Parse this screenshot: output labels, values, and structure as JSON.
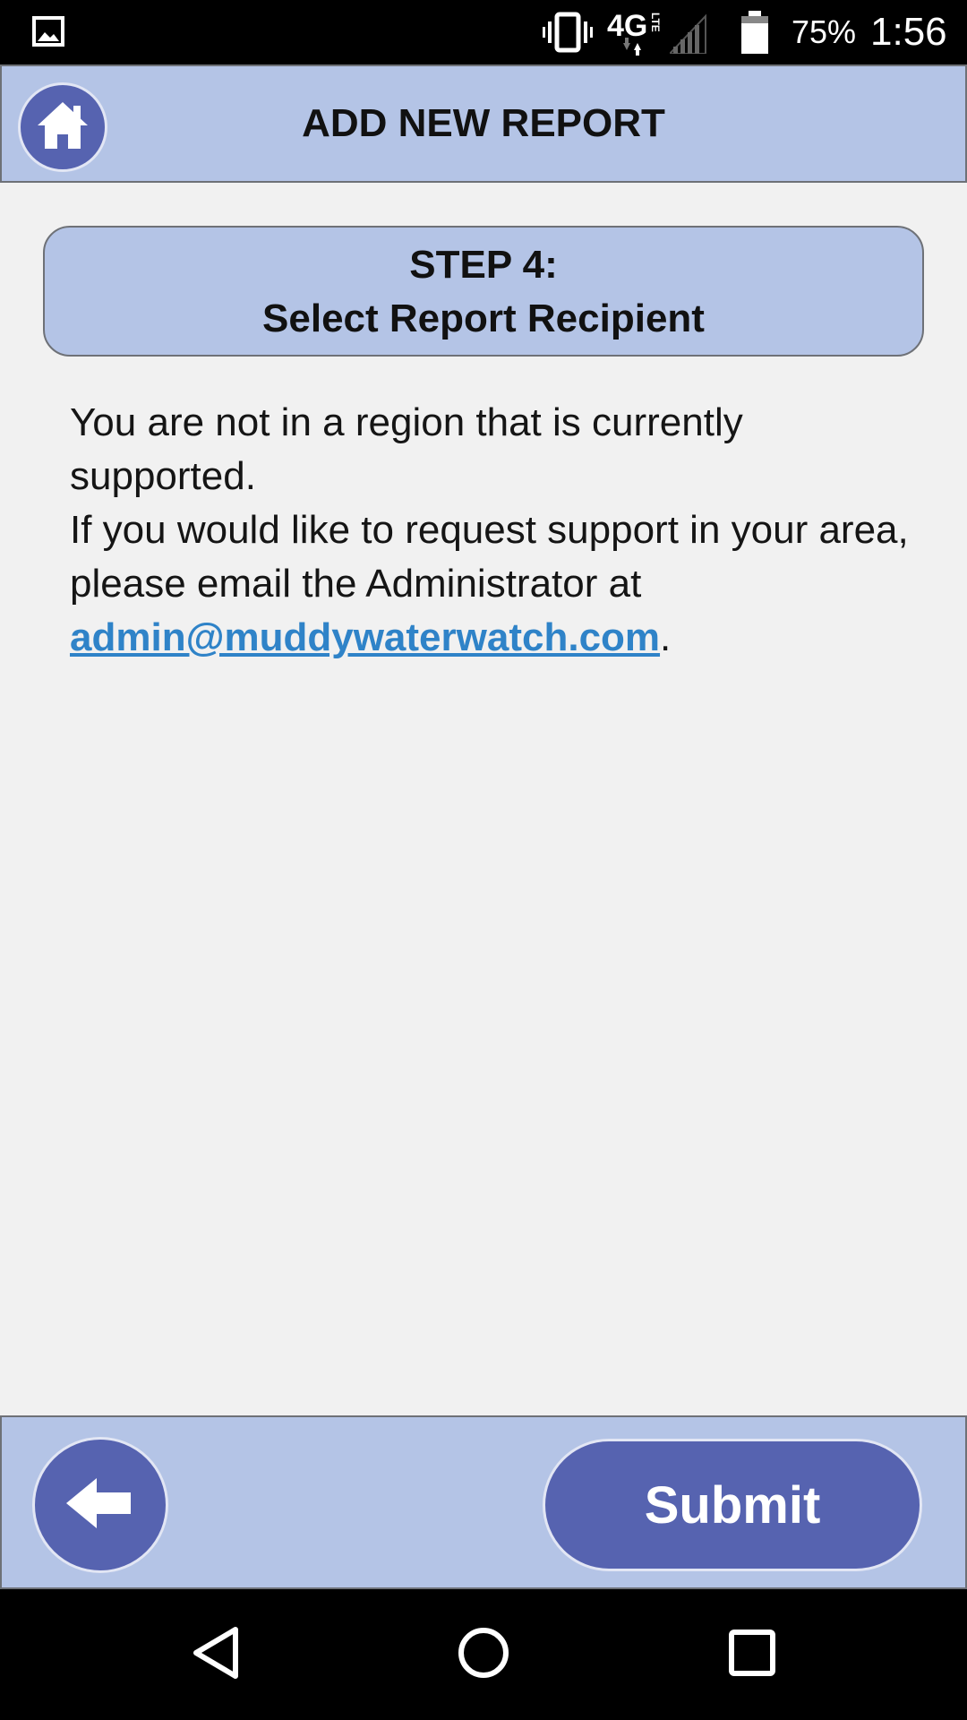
{
  "status_bar": {
    "battery_percent": "75%",
    "time": "1:56",
    "network_type": "4G",
    "network_sub": "LTE",
    "icons": [
      "gallery-icon",
      "vibrate-icon",
      "network-icon",
      "signal-icon",
      "battery-icon"
    ]
  },
  "header": {
    "title": "ADD NEW REPORT",
    "home_icon": "home-icon"
  },
  "step": {
    "number": "STEP 4:",
    "title": "Select Report Recipient"
  },
  "message": {
    "line1": "You are not in a region that is currently supported.",
    "line2": "If you would like to request support in your area,",
    "line3": "please email the Administrator at",
    "email": "admin@muddywaterwatch.com",
    "period": "."
  },
  "footer": {
    "back_icon": "arrow-left-icon",
    "submit_label": "Submit"
  },
  "nav_bar": {
    "icons": [
      "nav-back-icon",
      "nav-home-icon",
      "nav-recents-icon"
    ]
  },
  "colors": {
    "header_bg": "#b4c4e6",
    "button_bg": "#5663b0",
    "link": "#2f83c8",
    "page_bg": "#f1f1f1"
  }
}
